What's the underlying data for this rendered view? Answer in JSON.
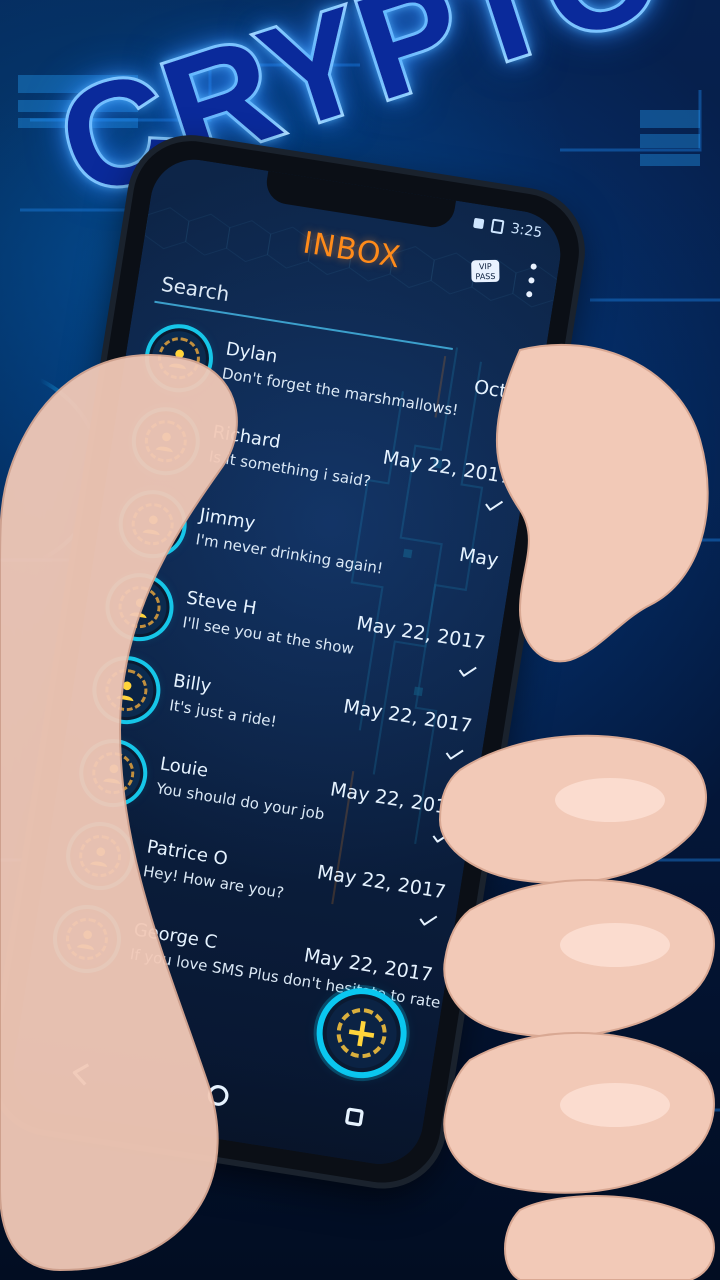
{
  "promo": {
    "title": "CRYPTO"
  },
  "status_bar": {
    "time": "3:25"
  },
  "app_bar": {
    "title": "INBOX",
    "vip_badge": "VIP PASS",
    "menu_icon": "more-vert-icon"
  },
  "search": {
    "placeholder": "Search"
  },
  "conversations": [
    {
      "name": "Dylan",
      "message": "Don't forget the marshmallows!",
      "date": "Oct 2",
      "read": false
    },
    {
      "name": "Richard",
      "message": "Is it something i said?",
      "date": "May 22, 2017",
      "read": true
    },
    {
      "name": "Jimmy",
      "message": "I'm never drinking again!",
      "date": "May",
      "read": false
    },
    {
      "name": "Steve H",
      "message": "I'll see you at the show",
      "date": "May 22, 2017",
      "read": true
    },
    {
      "name": "Billy",
      "message": "It's just a ride!",
      "date": "May 22, 2017",
      "read": true
    },
    {
      "name": "Louie",
      "message": "You should do your job",
      "date": "May 22, 2017",
      "read": true
    },
    {
      "name": "Patrice O",
      "message": "Hey! How are you?",
      "date": "May 22, 2017",
      "read": true
    },
    {
      "name": "George C",
      "message": "If you love SMS Plus don't hesitate to rate it!",
      "date": "May 22, 2017",
      "read": false
    }
  ],
  "fab": {
    "label": "+",
    "icon": "plus-icon"
  },
  "nav_bar": {
    "back_icon": "back-icon",
    "home_icon": "home-icon",
    "recents_icon": "recents-icon"
  },
  "colors": {
    "accent_orange": "#ff8b1a",
    "neon_cyan": "#16c6e8",
    "title_blue": "#0a2a9b",
    "background_navy": "#061a3d"
  }
}
